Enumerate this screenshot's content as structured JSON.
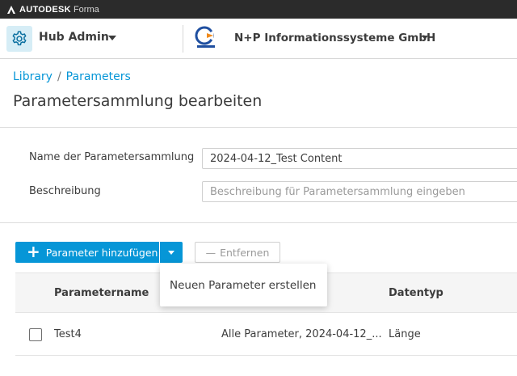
{
  "brand": {
    "name": "AUTODESK",
    "product": "Forma"
  },
  "topnav": {
    "hub_icon": "gear-icon",
    "hub_name": "Hub Admin",
    "company_logo_text": "N+P",
    "company_name": "N+P Informationssysteme GmbH"
  },
  "breadcrumb": {
    "items": [
      "Library",
      "Parameters"
    ],
    "separator": "/"
  },
  "page": {
    "title": "Parametersammlung bearbeiten"
  },
  "form": {
    "name_label": "Name der Parametersammlung",
    "name_value": "2024-04-12_Test Content",
    "description_label": "Beschreibung",
    "description_placeholder": "Beschreibung für Parametersammlung eingeben"
  },
  "toolbar": {
    "add_label": "Parameter hinzufügen",
    "remove_label": "Entfernen"
  },
  "dropdown": {
    "items": [
      "Neuen Parameter erstellen"
    ]
  },
  "table": {
    "headers": [
      "Parametername",
      "Datentyp"
    ],
    "rows": [
      {
        "name": "Test4",
        "collection": "Alle Parameter, 2024-04-12_...",
        "datatype": "Länge"
      }
    ]
  },
  "colors": {
    "accent": "#0696d7",
    "brand_bar": "#2b2b2b",
    "hub_icon_bg": "#d6edf6",
    "logo_blue": "#1f4fa0",
    "logo_orange": "#f08a1c"
  }
}
